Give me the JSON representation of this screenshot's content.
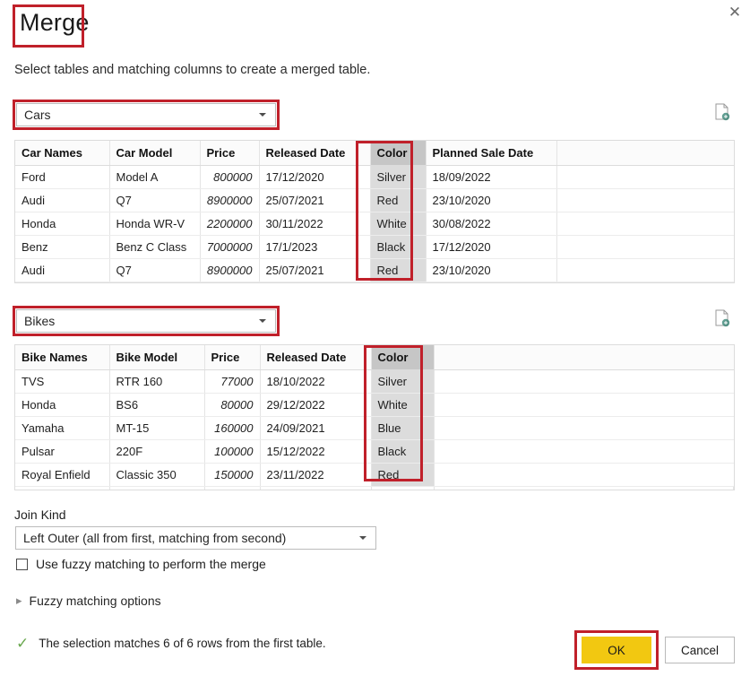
{
  "dialog": {
    "title": "Merge",
    "subtitle": "Select tables and matching columns to create a merged table.",
    "close_icon": "close-icon"
  },
  "first_table": {
    "selector_value": "Cars",
    "preview_icon": "table-preview-icon",
    "columns": [
      "Car Names",
      "Car Model",
      "Price",
      "Released Date",
      "Color",
      "Planned Sale Date"
    ],
    "selected_column": "Color",
    "rows": [
      [
        "Ford",
        "Model A",
        "800000",
        "17/12/2020",
        "Silver",
        "18/09/2022"
      ],
      [
        "Audi",
        "Q7",
        "8900000",
        "25/07/2021",
        "Red",
        "23/10/2020"
      ],
      [
        "Honda",
        "Honda WR-V",
        "2200000",
        "30/11/2022",
        "White",
        "30/08/2022"
      ],
      [
        "Benz",
        "Benz C Class",
        "7000000",
        "17/1/2023",
        "Black",
        "17/12/2020"
      ],
      [
        "Audi",
        "Q7",
        "8900000",
        "25/07/2021",
        "Red",
        "23/10/2020"
      ]
    ]
  },
  "second_table": {
    "selector_value": "Bikes",
    "preview_icon": "table-preview-icon",
    "columns": [
      "Bike Names",
      "Bike Model",
      "Price",
      "Released Date",
      "Color"
    ],
    "selected_column": "Color",
    "rows": [
      [
        "TVS",
        "RTR 160",
        "77000",
        "18/10/2022",
        "Silver"
      ],
      [
        "Honda",
        "BS6",
        "80000",
        "29/12/2022",
        "White"
      ],
      [
        "Yamaha",
        "MT-15",
        "160000",
        "24/09/2021",
        "Blue"
      ],
      [
        "Pulsar",
        "220F",
        "100000",
        "15/12/2022",
        "Black"
      ],
      [
        "Royal Enfield",
        "Classic 350",
        "150000",
        "23/11/2022",
        "Red"
      ]
    ]
  },
  "join": {
    "label": "Join Kind",
    "value": "Left Outer (all from first, matching from second)",
    "fuzzy_checkbox_label": "Use fuzzy matching to perform the merge",
    "fuzzy_checked": false,
    "fuzzy_options_label": "Fuzzy matching options",
    "fuzzy_options_expanded": false
  },
  "status": {
    "icon": "check-icon",
    "message": "The selection matches 6 of 6 rows from the first table."
  },
  "footer": {
    "ok_label": "OK",
    "cancel_label": "Cancel"
  },
  "annotation_color": "#c0202a",
  "accent_color": "#f2c811"
}
